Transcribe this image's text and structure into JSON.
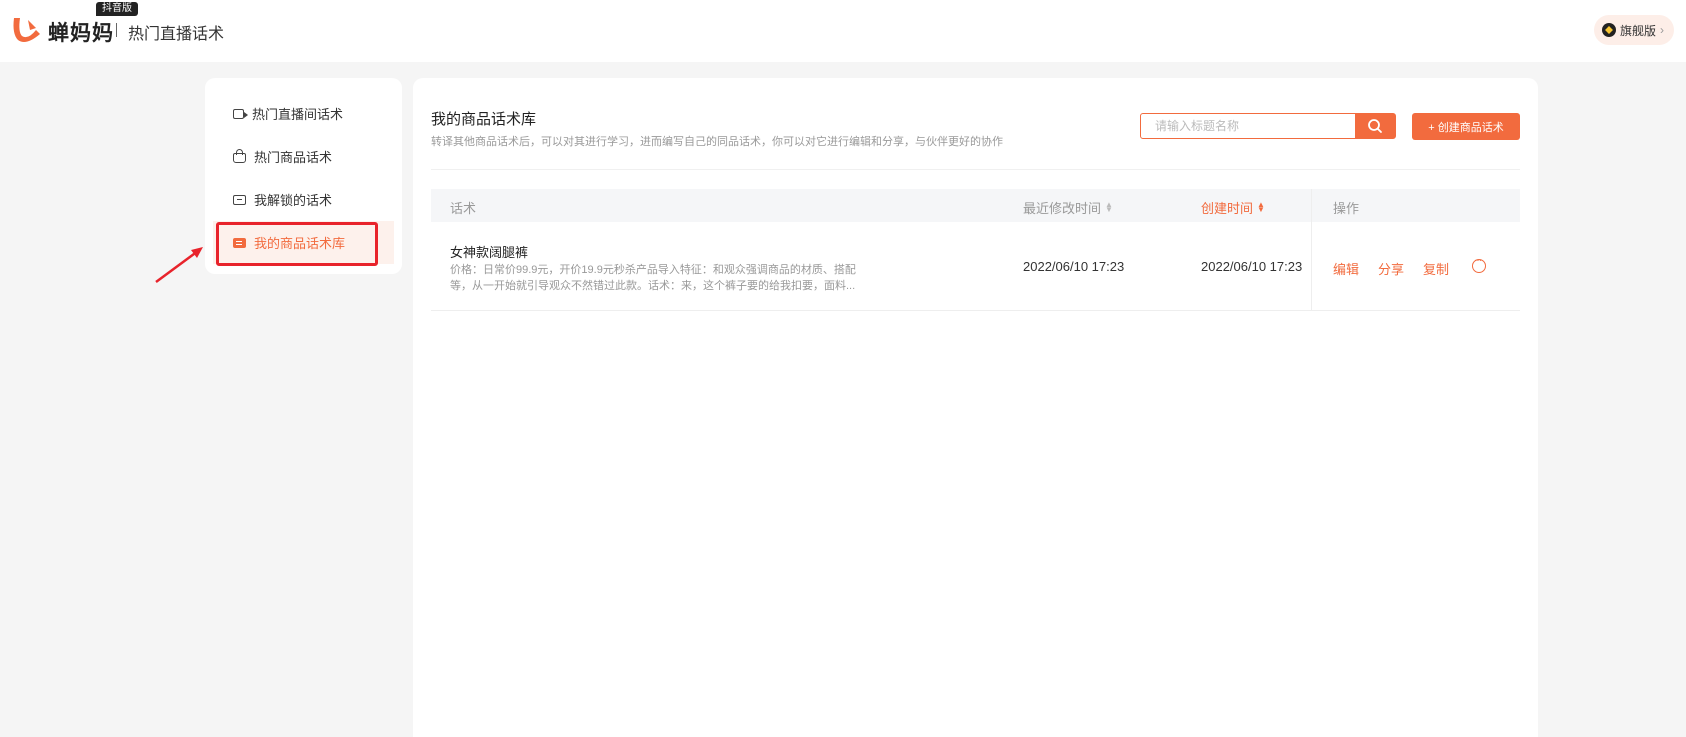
{
  "header": {
    "brand": "蝉妈妈",
    "edition_tag": "抖音版",
    "product_name": "热门直播话术",
    "flagship_label": "旗舰版",
    "flagship_icon": "gem-icon",
    "accent": "#f26b3e"
  },
  "sidebar": {
    "items": [
      {
        "label": "热门直播间话术",
        "icon": "video-icon",
        "active": false
      },
      {
        "label": "热门商品话术",
        "icon": "bag-icon",
        "active": false
      },
      {
        "label": "我解锁的话术",
        "icon": "chat-icon",
        "active": false
      },
      {
        "label": "我的商品话术库",
        "icon": "note-icon",
        "active": true
      }
    ]
  },
  "main": {
    "title": "我的商品话术库",
    "description": "转译其他商品话术后，可以对其进行学习，进而编写自己的同品话术，你可以对它进行编辑和分享，与伙伴更好的协作",
    "search": {
      "placeholder": "请输入标题名称",
      "value": ""
    },
    "create_button": "+ 创建商品话术",
    "table": {
      "columns": {
        "script": "话术",
        "modified": "最近修改时间",
        "created": "创建时间",
        "actions": "操作"
      },
      "sorted_by": "created",
      "rows": [
        {
          "title": "女神款阔腿裤",
          "description": "价格：日常价99.9元，开价19.9元秒杀产品导入特征：和观众强调商品的材质、搭配等，从一开始就引导观众不然错过此款。话术：来，这个裤子要的给我扣要，面料...",
          "modified": "2022/06/10 17:23",
          "created": "2022/06/10 17:23",
          "actions": {
            "edit": "编辑",
            "share": "分享",
            "copy": "复制"
          }
        }
      ]
    }
  }
}
